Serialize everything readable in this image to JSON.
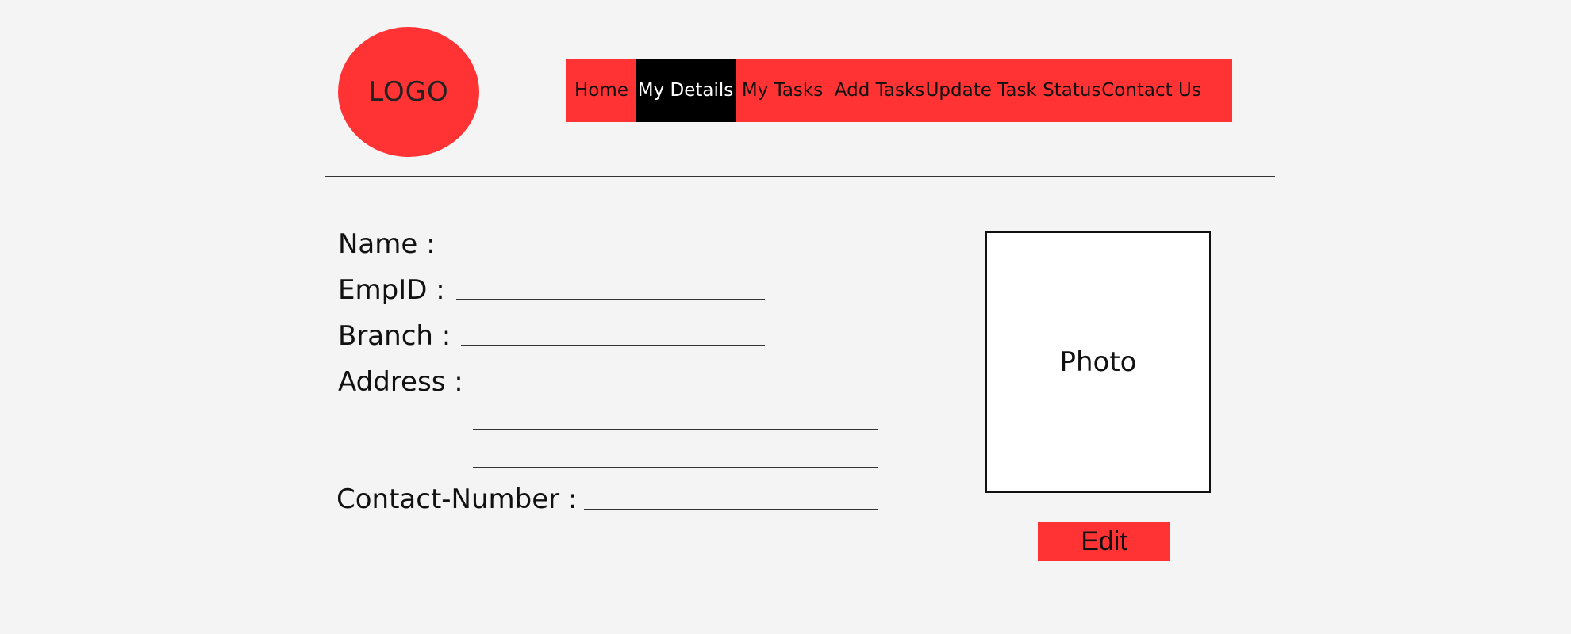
{
  "logo": {
    "text": "LOGO"
  },
  "nav": {
    "items": [
      {
        "label": "Home"
      },
      {
        "label": "My Details"
      },
      {
        "label": "My Tasks"
      },
      {
        "label": "Add Tasks"
      },
      {
        "label": "Update Task Status"
      },
      {
        "label": "Contact Us"
      }
    ],
    "active_index": 1
  },
  "form": {
    "name_label": "Name :",
    "empid_label": "EmpID :",
    "branch_label": "Branch :",
    "address_label": "Address :",
    "contact_label": "Contact-Number :"
  },
  "photo": {
    "text": "Photo"
  },
  "actions": {
    "edit_label": "Edit"
  },
  "colors": {
    "accent": "#ff3333",
    "background": "#f4f4f4",
    "active_nav_bg": "#000000",
    "active_nav_text": "#ffffff"
  }
}
